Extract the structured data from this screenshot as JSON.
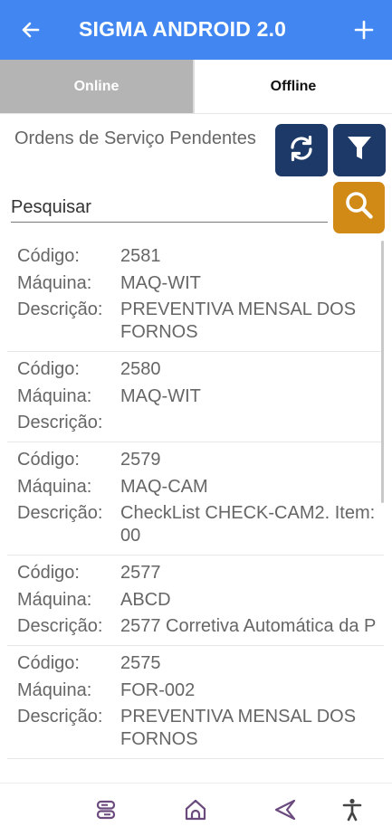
{
  "app": {
    "title": "SIGMA ANDROID 2.0",
    "back_icon": "arrow-left-icon",
    "add_icon": "plus-icon"
  },
  "tabs": [
    {
      "label": "Online",
      "active": false
    },
    {
      "label": "Offline",
      "active": true
    }
  ],
  "section": {
    "title": "Ordens de Serviço Pendentes"
  },
  "search": {
    "placeholder": "Pesquisar"
  },
  "labels": {
    "codigo": "Código:",
    "maquina": "Máquina:",
    "descricao": "Descrição:"
  },
  "orders": [
    {
      "codigo": "2581",
      "maquina": "MAQ-WIT",
      "descricao": "PREVENTIVA MENSAL DOS FORNOS"
    },
    {
      "codigo": "2580",
      "maquina": "MAQ-WIT",
      "descricao": ""
    },
    {
      "codigo": "2579",
      "maquina": "MAQ-CAM",
      "descricao": "CheckList CHECK-CAM2. Item: 00"
    },
    {
      "codigo": "2577",
      "maquina": "ABCD",
      "descricao": "2577 Corretiva Automática da P"
    },
    {
      "codigo": "2575",
      "maquina": "FOR-002",
      "descricao": "PREVENTIVA MENSAL DOS FORNOS"
    }
  ],
  "bottom_nav": [
    "server-icon",
    "home-icon",
    "back-triangle-icon",
    "accessibility-icon"
  ],
  "colors": {
    "appbar": "#4287f1",
    "dark_button": "#1c3967",
    "search_button": "#d28a16",
    "tab_online": "#b4b4b4",
    "nav_icon": "#6b4a7e"
  }
}
